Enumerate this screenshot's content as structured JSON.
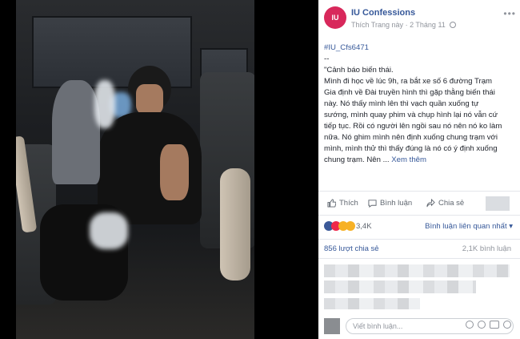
{
  "photo": {
    "description_icon": "photo"
  },
  "post": {
    "page_name": "IU Confessions",
    "avatar_text": "IU",
    "follow_label": "Thích Trang này",
    "date": "2 Tháng 11",
    "separator": "·",
    "hashtag": "#IU_Cfs6471",
    "dash": "--",
    "title_line": "\"Cảnh báo biến thái.",
    "body_lines": [
      "Mình đi học về lúc 9h, ra bắt xe số 6 đường Trạm",
      "Gia định về Đài truyền hình thì gặp thằng biến thái",
      "này. Nó thấy mình lên thì vạch quần xuống tự",
      "sướng, mình quay phim và chụp hình lại nó vẫn cứ",
      "tiếp tục. Rồi có người lên ngồi sau nó nên nó ko làm",
      "nữa. Nó ghim mình nên định xuống chung trạm với",
      "mình, mình thử thì thấy đúng là nó có ý định xuống"
    ],
    "last_line_prefix": "chung trạm. Nên ...",
    "see_more": "Xem thêm",
    "menu": "•••"
  },
  "actions": {
    "like": "Thích",
    "comment": "Bình luận",
    "share": "Chia sẻ"
  },
  "reactions": {
    "count": "3,4K",
    "sort_label": "Bình luận liên quan nhất ▾"
  },
  "stats": {
    "shares": "856 lượt chia sẻ",
    "comments": "2,1K bình luận"
  },
  "comment_input": {
    "placeholder": "Viết bình luận..."
  },
  "colors": {
    "link": "#365899",
    "like_blue": "#3b5998",
    "avatar": "#d8285b"
  }
}
